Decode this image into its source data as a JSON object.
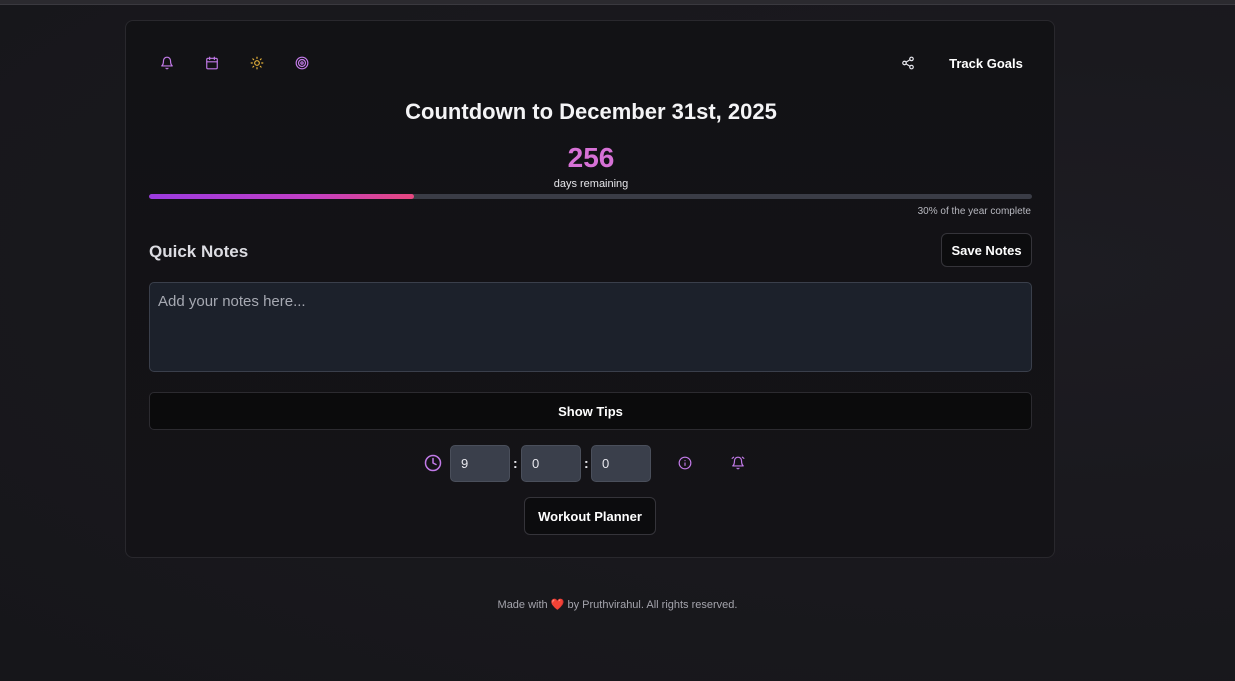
{
  "header": {
    "icons": [
      "bell-icon",
      "calendar-icon",
      "sun-icon",
      "target-icon"
    ],
    "share_icon": "share-icon",
    "track_goals_label": "Track Goals"
  },
  "countdown": {
    "title": "Countdown to December 31st, 2025",
    "days": "256",
    "days_label": "days remaining",
    "progress_fraction": 0.3,
    "progress_text": "30% of the year complete"
  },
  "notes": {
    "heading": "Quick Notes",
    "save_label": "Save Notes",
    "placeholder": "Add your notes here...",
    "value": ""
  },
  "tips": {
    "label": "Show Tips"
  },
  "timer": {
    "hours": "9",
    "minutes": "0",
    "seconds": "0",
    "separator": ":"
  },
  "workout": {
    "label": "Workout Planner"
  },
  "footer": {
    "prefix": "Made with",
    "heart": "❤️",
    "suffix": "by Pruthvirahul. All rights reserved."
  },
  "colors": {
    "accent": "#d671d6",
    "icon_purple": "#c27ae8",
    "sun_yellow": "#e6b23a",
    "progress_start": "#9b3be0",
    "progress_end": "#e6477f"
  }
}
